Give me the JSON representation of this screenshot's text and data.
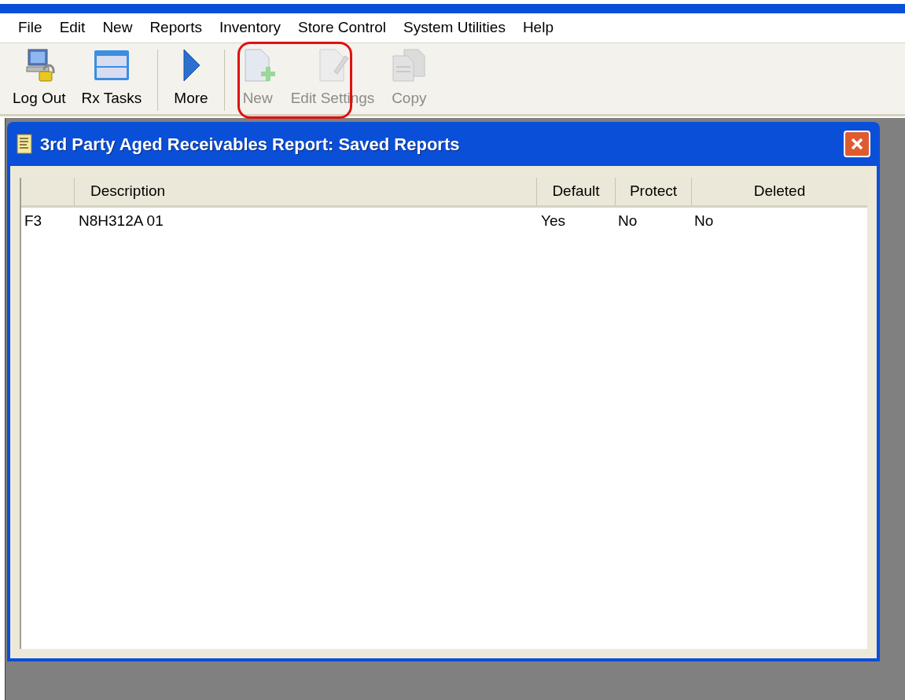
{
  "menu": [
    "File",
    "Edit",
    "New",
    "Reports",
    "Inventory",
    "Store Control",
    "System Utilities",
    "Help"
  ],
  "toolbar": [
    {
      "label": "Log Out",
      "kind": "logout",
      "disabled": false
    },
    {
      "label": "Rx Tasks",
      "kind": "tasks",
      "disabled": false
    },
    {
      "label": "More",
      "kind": "more",
      "disabled": false
    },
    {
      "label": "New",
      "kind": "new",
      "disabled": true
    },
    {
      "label": "Edit Settings",
      "kind": "edit",
      "disabled": true
    },
    {
      "label": "Copy",
      "kind": "copy",
      "disabled": true
    }
  ],
  "dialog": {
    "title": "3rd Party Aged Receivables Report: Saved Reports",
    "table": {
      "columns": [
        "",
        "Description",
        "Default",
        "Protect",
        "Deleted"
      ],
      "rows": [
        [
          "F3",
          "N8H312A 01",
          "Yes",
          "No",
          "No"
        ]
      ]
    }
  }
}
